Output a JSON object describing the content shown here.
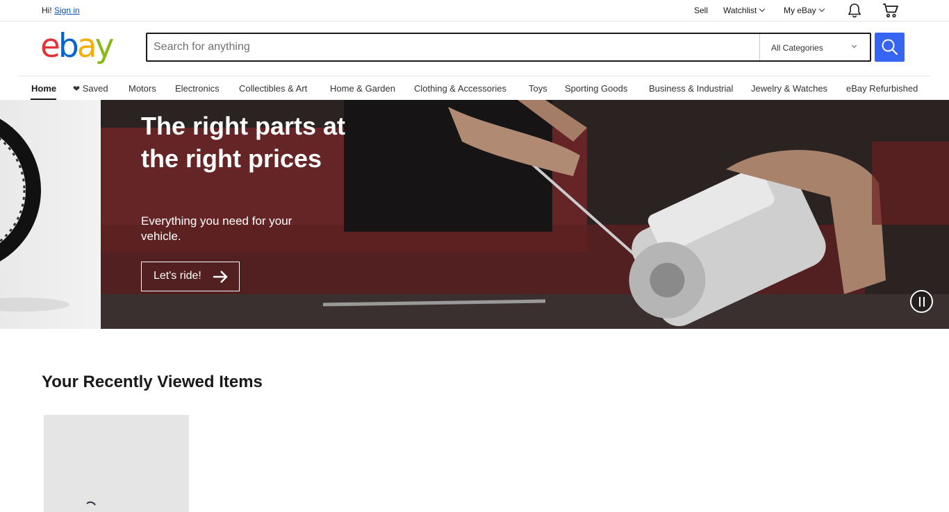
{
  "topbar": {
    "greeting": "Hi!",
    "sign_in": "Sign in",
    "sell": "Sell",
    "watchlist": "Watchlist",
    "my_ebay": "My eBay"
  },
  "header": {
    "logo_text": "ebay",
    "search_placeholder": "Search for anything",
    "category_selected": "All Categories"
  },
  "nav": {
    "items": [
      "Home",
      "Saved",
      "Motors",
      "Electronics",
      "Collectibles & Art",
      "Home & Garden",
      "Clothing & Accessories",
      "Toys",
      "Sporting Goods",
      "Business & Industrial",
      "Jewelry & Watches",
      "eBay Refurbished"
    ]
  },
  "hero": {
    "title": "The right parts at the right prices",
    "subtitle": "Everything you need for your vehicle.",
    "cta": "Let's ride!"
  },
  "recently_viewed": {
    "title": "Your Recently Viewed Items"
  },
  "colors": {
    "accent_blue": "#3665f3",
    "link_blue": "#0654ba",
    "logo_red": "#e53238",
    "logo_blue": "#0064d2",
    "logo_yellow": "#f5af02",
    "logo_green": "#86b817"
  }
}
